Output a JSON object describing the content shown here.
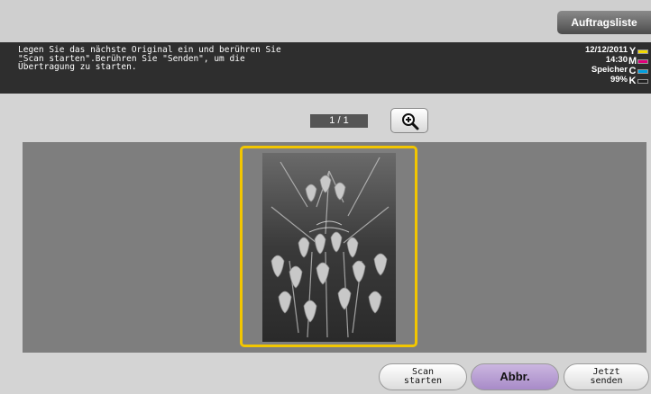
{
  "header": {
    "job_list_label": "Auftragsliste"
  },
  "message": {
    "text": "Legen Sie das nächste Original ein und berühren Sie\n\"Scan starten\".Berühren Sie \"Senden\", um die\nÜbertragung zu starten."
  },
  "status": {
    "date": "12/12/2011",
    "time": "14:30",
    "memory_label": "Speicher",
    "memory_value": "99%",
    "toner": [
      {
        "letter": "Y",
        "color": "#f2d800",
        "level": 1.0
      },
      {
        "letter": "M",
        "color": "#e0007a",
        "level": 1.0
      },
      {
        "letter": "C",
        "color": "#00a0e0",
        "level": 1.0
      },
      {
        "letter": "K",
        "color": "#222222",
        "level": 1.0
      }
    ]
  },
  "preview": {
    "page_indicator": "1 / 1",
    "zoom_icon": "magnifier-plus-icon"
  },
  "footer": {
    "scan_start_label": "Scan\nstarten",
    "cancel_label": "Abbr.",
    "send_now_label": "Jetzt\nsenden"
  }
}
